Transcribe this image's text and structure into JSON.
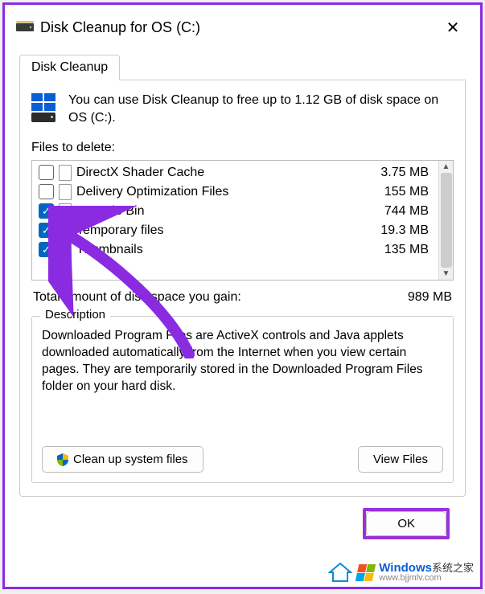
{
  "window": {
    "title": "Disk Cleanup for OS (C:)"
  },
  "tab": {
    "label": "Disk Cleanup"
  },
  "info": {
    "text": "You can use Disk Cleanup to free up to 1.12 GB of disk space on OS (C:)."
  },
  "filesLabel": "Files to delete:",
  "files": [
    {
      "name": "DirectX Shader Cache",
      "size": "3.75 MB",
      "checked": false,
      "iconType": "file"
    },
    {
      "name": "Delivery Optimization Files",
      "size": "155 MB",
      "checked": false,
      "iconType": "file"
    },
    {
      "name": "Recycle Bin",
      "size": "744 MB",
      "checked": true,
      "iconType": "recycle"
    },
    {
      "name": "Temporary files",
      "size": "19.3 MB",
      "checked": true,
      "iconType": "file"
    },
    {
      "name": "Thumbnails",
      "size": "135 MB",
      "checked": true,
      "iconType": "file"
    }
  ],
  "total": {
    "label": "Total amount of disk space you gain:",
    "value": "989 MB"
  },
  "description": {
    "title": "Description",
    "text": "Downloaded Program Files are ActiveX controls and Java applets downloaded automatically from the Internet when you view certain pages. They are temporarily stored in the Downloaded Program Files folder on your hard disk."
  },
  "buttons": {
    "cleanup": "Clean up system files",
    "view": "View Files",
    "ok": "OK"
  },
  "watermark": {
    "brand": "Windows",
    "sub": "系统之家",
    "url": "www.bjjmlv.com"
  }
}
